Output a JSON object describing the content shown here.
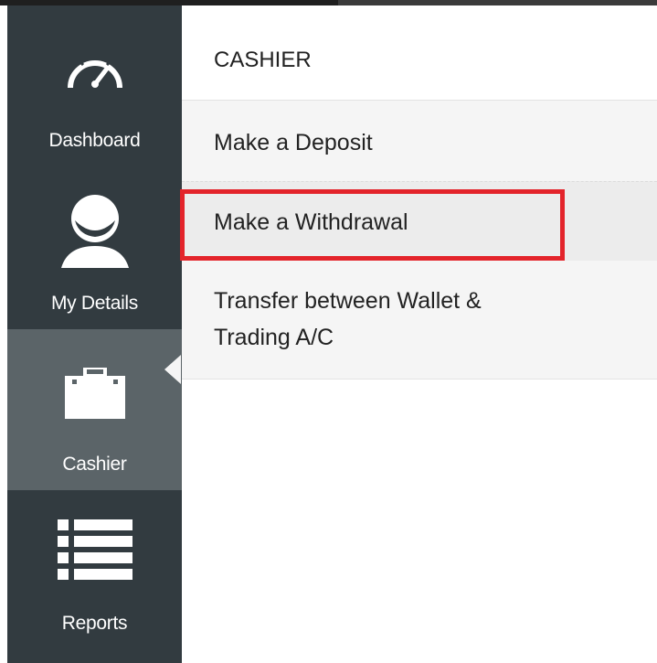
{
  "sidebar": {
    "items": [
      {
        "label": "Dashboard",
        "icon": "speedometer-icon"
      },
      {
        "label": "My Details",
        "icon": "user-icon"
      },
      {
        "label": "Cashier",
        "icon": "briefcase-icon",
        "active": true
      },
      {
        "label": "Reports",
        "icon": "list-icon"
      }
    ]
  },
  "submenu": {
    "title": "CASHIER",
    "items": [
      {
        "label": "Make a Deposit"
      },
      {
        "label": "Make a Withdrawal",
        "highlighted": true
      },
      {
        "label_line1": "Transfer between Wallet &",
        "label_line2": "Trading A/C"
      }
    ]
  },
  "colors": {
    "sidebar_bg": "#323b40",
    "sidebar_active_bg": "#5b6468",
    "submenu_bg": "#f5f5f5",
    "highlight_border": "#e3242b"
  }
}
